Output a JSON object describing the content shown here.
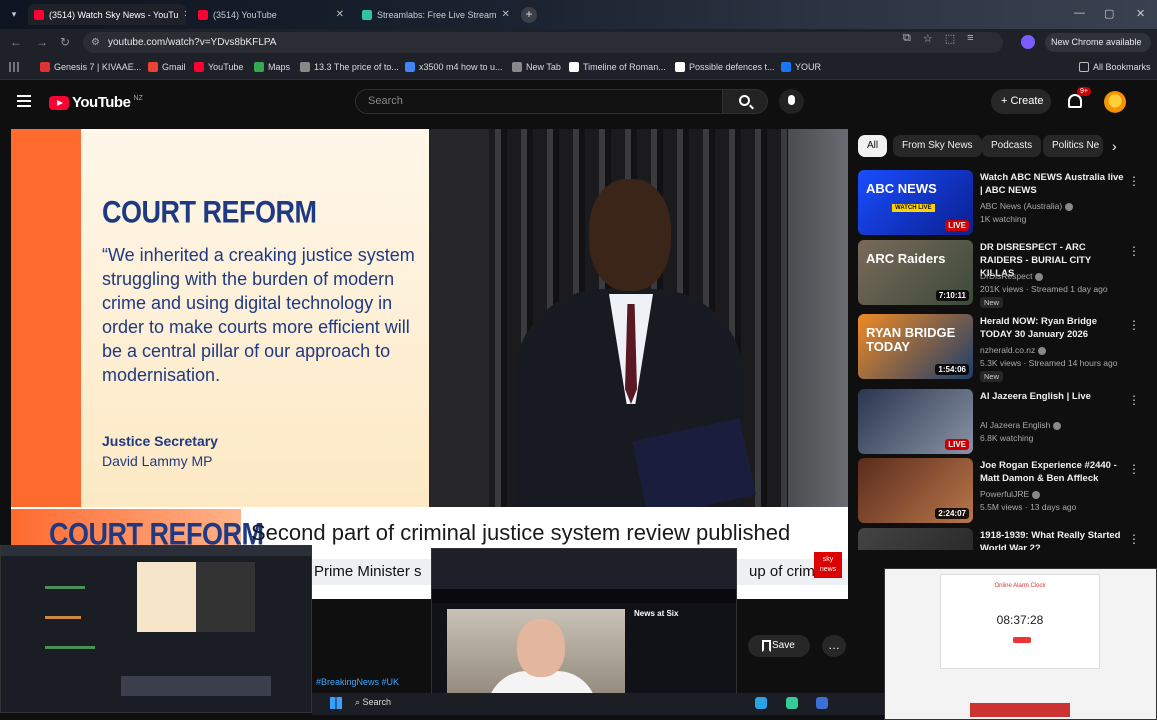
{
  "browser": {
    "tabs": [
      {
        "label": "(3514) Watch Sky News - YouTu",
        "active": true,
        "icon": "youtube-icon"
      },
      {
        "label": "(3514) YouTube",
        "active": false,
        "icon": "youtube-icon"
      },
      {
        "label": "Streamlabs: Free Live Stream",
        "active": false,
        "icon": "streamlabs-icon"
      }
    ],
    "url": "youtube.com/watch?v=YDvs8bKFLPA",
    "new_chrome_label": "New Chrome available",
    "bookmarks": [
      {
        "label": "Genesis 7 | KIVAAE...",
        "color": "#d33"
      },
      {
        "label": "Gmail",
        "color": "#ea4335"
      },
      {
        "label": "YouTube",
        "color": "#ff0033"
      },
      {
        "label": "Maps",
        "color": "#34a853"
      },
      {
        "label": "13.3 The price of to...",
        "color": "#888"
      },
      {
        "label": "x3500 m4 how to u...",
        "color": "#4285f4"
      },
      {
        "label": "New Tab",
        "color": "#888"
      },
      {
        "label": "Timeline of Roman...",
        "color": "#fff"
      },
      {
        "label": "Possible defences t...",
        "color": "#fff"
      },
      {
        "label": "YOUR",
        "color": "#1877f2"
      }
    ],
    "all_bookmarks_label": "All Bookmarks"
  },
  "youtube": {
    "logo_text": "YouTube",
    "country_code": "NZ",
    "search_placeholder": "Search",
    "create_label": "Create",
    "notification_count": "9+"
  },
  "video": {
    "card_heading": "COURT REFORM",
    "quote": "“We inherited a creaking justice system struggling with the burden of modern crime and using digital technology in order to make courts more efficient will be a central pillar of our approach to modernisation.",
    "role": "Justice Secretary",
    "name": "David Lammy MP",
    "ribbon": "COURT REFORM",
    "headline": "Second part of criminal justice system review published",
    "ticker": "Prime Minister s",
    "ticker_tail": "up of crimin",
    "sky_logo": "sky news"
  },
  "chips": [
    {
      "label": "All",
      "active": true
    },
    {
      "label": "From Sky News",
      "active": false
    },
    {
      "label": "Podcasts",
      "active": false
    },
    {
      "label": "Politics Ne",
      "active": false
    }
  ],
  "recommendations": [
    {
      "title": "Watch ABC NEWS Australia live | ABC NEWS",
      "channel": "ABC News (Australia)",
      "meta": "1K watching",
      "badge": "LIVE",
      "new": "",
      "thumb_text": "ABC NEWS",
      "thumb_sub": "WATCH LIVE",
      "colors": [
        "#1a4dff",
        "#0a1f8f"
      ]
    },
    {
      "title": "DR DISRESPECT - ARC RAIDERS - BURIAL CITY KILLAS",
      "channel": "DrDisRespect",
      "meta": "201K views · Streamed 1 day ago",
      "badge": "7:10:11",
      "new": "New",
      "thumb_text": "ARC Raiders",
      "thumb_sub": "",
      "colors": [
        "#7a6a5a",
        "#3b4a3a"
      ]
    },
    {
      "title": "Herald NOW: Ryan Bridge TODAY 30 January 2026",
      "channel": "nzherald.co.nz",
      "meta": "5.3K views · Streamed 14 hours ago",
      "badge": "1:54:06",
      "new": "New",
      "thumb_text": "RYAN BRIDGE TODAY",
      "thumb_sub": "",
      "colors": [
        "#f08a24",
        "#1d3d6b"
      ]
    },
    {
      "title": "Al Jazeera English | Live",
      "channel": "Al Jazeera English",
      "meta": "6.8K watching",
      "badge": "LIVE",
      "new": "",
      "thumb_text": "",
      "thumb_sub": "",
      "colors": [
        "#2a3650",
        "#8a93a5"
      ]
    },
    {
      "title": "Joe Rogan Experience #2440 - Matt Damon & Ben Affleck",
      "channel": "PowerfulJRE",
      "meta": "5.5M views · 13 days ago",
      "badge": "2:24:07",
      "new": "",
      "thumb_text": "",
      "thumb_sub": "",
      "colors": [
        "#5a2c1c",
        "#b9764a"
      ]
    },
    {
      "title": "1918-1939: What Really Started World War 2?",
      "channel": "",
      "meta": "",
      "badge": "",
      "new": "",
      "thumb_text": "",
      "thumb_sub": "",
      "colors": [
        "#444",
        "#222"
      ]
    }
  ],
  "actions": {
    "save_label": "Save",
    "more_label": "…",
    "hashtags": "#BreakingNews #UK"
  },
  "overlays": {
    "sky_title": "News at Six",
    "clock_time": "08:37:28",
    "clock_label": "Online Alarm Clock",
    "taskbar_search": "Search"
  }
}
